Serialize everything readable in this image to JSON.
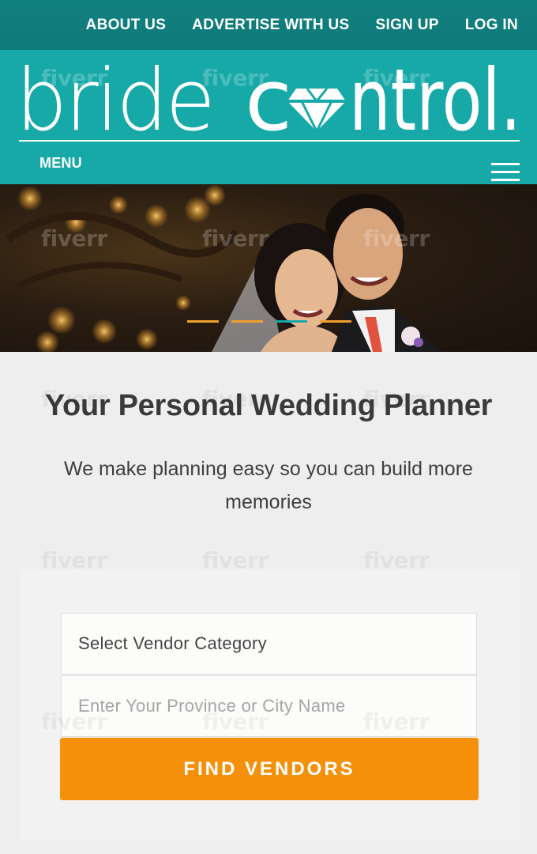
{
  "topnav": {
    "links": [
      "ABOUT US",
      "ADVERTISE WITH US",
      "SIGN UP",
      "LOG IN"
    ]
  },
  "brand": {
    "logo_text": "bride control.",
    "menu_label": "MENU"
  },
  "hero": {
    "slides_total": 4,
    "active_slide": 3
  },
  "main": {
    "headline": "Your Personal Wedding Planner",
    "subtext": "We make planning easy so you can build more memories"
  },
  "search": {
    "category_value": "Select Vendor Category",
    "location_placeholder": "Enter Your Province or City Name",
    "button_label": "FIND VENDORS"
  },
  "watermark": "fiverr",
  "colors": {
    "teal": "#17a9a8",
    "dark_teal": "#10807f",
    "orange": "#f5900a",
    "dot_orange": "#f0a030"
  },
  "icons": {
    "logo_o": "diamond-icon",
    "menu": "hamburger-icon"
  }
}
